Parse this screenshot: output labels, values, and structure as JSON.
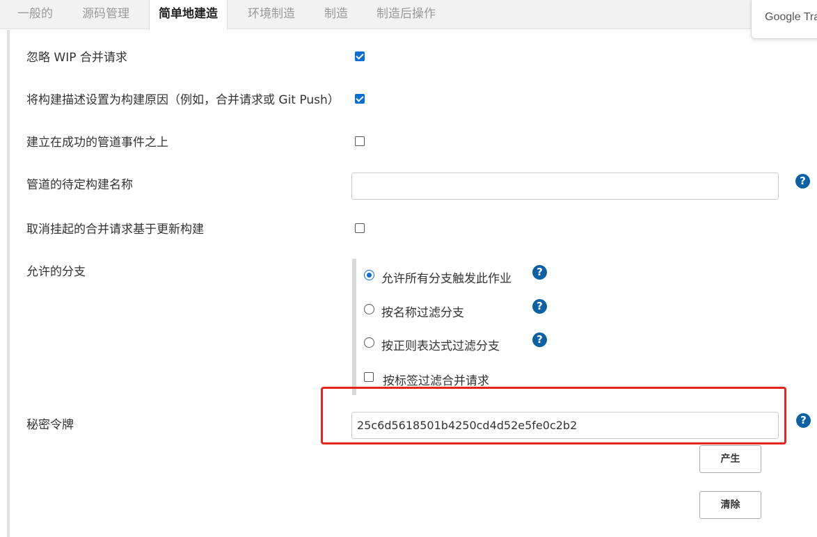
{
  "tabs": [
    {
      "label": "一般的",
      "active": false
    },
    {
      "label": "源码管理",
      "active": false
    },
    {
      "label": "简单地建造",
      "active": true
    },
    {
      "label": "环境制造",
      "active": false
    },
    {
      "label": "制造",
      "active": false
    },
    {
      "label": "制造后操作",
      "active": false
    }
  ],
  "google_translate": {
    "label": "Google Trar"
  },
  "settings": {
    "ignore_wip": {
      "label": "忽略 WIP 合并请求",
      "checked": true
    },
    "set_description": {
      "label": "将构建描述设置为构建原因（例如，合并请求或 Git Push）",
      "checked": true
    },
    "build_on_pipeline": {
      "label": "建立在成功的管道事件之上",
      "checked": false
    },
    "pending_build_name": {
      "label": "管道的待定构建名称",
      "value": ""
    },
    "cancel_pending": {
      "label": "取消挂起的合并请求基于更新构建",
      "checked": false
    }
  },
  "allowed_branches": {
    "label": "允许的分支",
    "options": [
      {
        "label": "允许所有分支触发此作业",
        "selected": true
      },
      {
        "label": "按名称过滤分支",
        "selected": false
      },
      {
        "label": "按正则表达式过滤分支",
        "selected": false
      }
    ],
    "filter_by_label": {
      "label": "按标签过滤合并请求",
      "checked": false
    }
  },
  "secret_token": {
    "label": "秘密令牌",
    "value": "25c6d5618501b4250cd4d52e5fe0c2b2",
    "generate_label": "产生",
    "clear_label": "清除"
  },
  "help_glyph": "?",
  "colors": {
    "accent": "#0a6ed1",
    "help": "#0b61a4",
    "highlight": "#e8231e"
  }
}
